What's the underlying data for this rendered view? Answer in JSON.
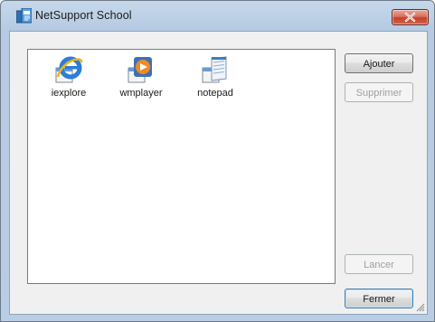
{
  "window": {
    "title": "NetSupport School"
  },
  "list": {
    "items": [
      {
        "label": "iexplore",
        "icon": "internet-explorer-icon"
      },
      {
        "label": "wmplayer",
        "icon": "windows-media-player-icon"
      },
      {
        "label": "notepad",
        "icon": "notepad-icon"
      }
    ]
  },
  "buttons": {
    "add": "Ajouter",
    "remove": "Supprimer",
    "launch": "Lancer",
    "close": "Fermer"
  },
  "colors": {
    "close_button": "#c8432f",
    "default_button_border": "#3c7fb1",
    "title_bar": "#bcd0e6"
  }
}
